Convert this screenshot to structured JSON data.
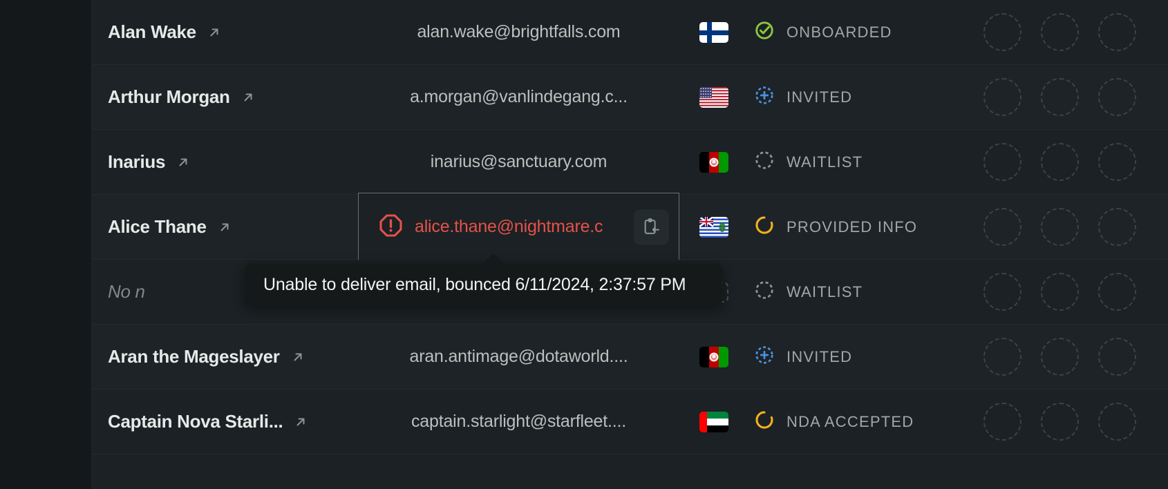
{
  "table": {
    "rows": [
      {
        "name": "Alan Wake",
        "email": "alan.wake@brightfalls.com",
        "country": "Finland",
        "flag_icon": "flag-fi",
        "status": "ONBOARDED",
        "status_icon": "check-circle-icon",
        "status_color": "#8ec63f",
        "email_error": false,
        "avatar_count": 3
      },
      {
        "name": "Arthur Morgan",
        "email": "a.morgan@vanlindegang.c...",
        "country": "United States",
        "flag_icon": "flag-us",
        "status": "INVITED",
        "status_icon": "plus-dashed-circle-icon",
        "status_color": "#4a90e2",
        "email_error": false,
        "avatar_count": 3
      },
      {
        "name": "Inarius",
        "email": "inarius@sanctuary.com",
        "country": "Afghanistan",
        "flag_icon": "flag-af",
        "status": "WAITLIST",
        "status_icon": "dashed-circle-icon",
        "status_color": "#8c9794",
        "email_error": false,
        "avatar_count": 3
      },
      {
        "name": "Alice Thane",
        "email": "alice.thane@nightmare.c",
        "country": "British Indian Ocean Territory",
        "flag_icon": "flag-io",
        "status": "PROVIDED INFO",
        "status_icon": "partial-circle-icon",
        "status_color": "#f2b01e",
        "email_error": true,
        "avatar_count": 3
      },
      {
        "name": "No n",
        "name_muted": true,
        "email": "",
        "country": "",
        "flag_icon": "flag-empty",
        "status": "WAITLIST",
        "status_icon": "dashed-circle-icon",
        "status_color": "#8c9794",
        "email_error": false,
        "avatar_count": 3
      },
      {
        "name": "Aran the Mageslayer",
        "email": "aran.antimage@dotaworld....",
        "country": "Afghanistan",
        "flag_icon": "flag-af",
        "status": "INVITED",
        "status_icon": "plus-dashed-circle-icon",
        "status_color": "#4a90e2",
        "email_error": false,
        "avatar_count": 3
      },
      {
        "name": "Captain Nova Starli...",
        "email": "captain.starlight@starfleet....",
        "country": "United Arab Emirates",
        "flag_icon": "flag-ae",
        "status": "NDA ACCEPTED",
        "status_icon": "partial-circle-icon",
        "status_color": "#f2b01e",
        "email_error": false,
        "avatar_count": 3
      }
    ]
  },
  "tooltip": {
    "text": "Unable to deliver email, bounced 6/11/2024, 2:37:57 PM"
  },
  "icons": {
    "external_link": "↗",
    "copy": "clipboard-paste-icon",
    "error": "error-octagon-icon"
  },
  "colors": {
    "background": "#14181a",
    "row_background": "#1b2124",
    "row_border": "#242b2e",
    "name_text": "#e6e9e8",
    "email_text": "#b9c1bf",
    "error_red": "#e4524b",
    "status_text": "#9fa9a6",
    "tooltip_bg": "#16191a"
  }
}
